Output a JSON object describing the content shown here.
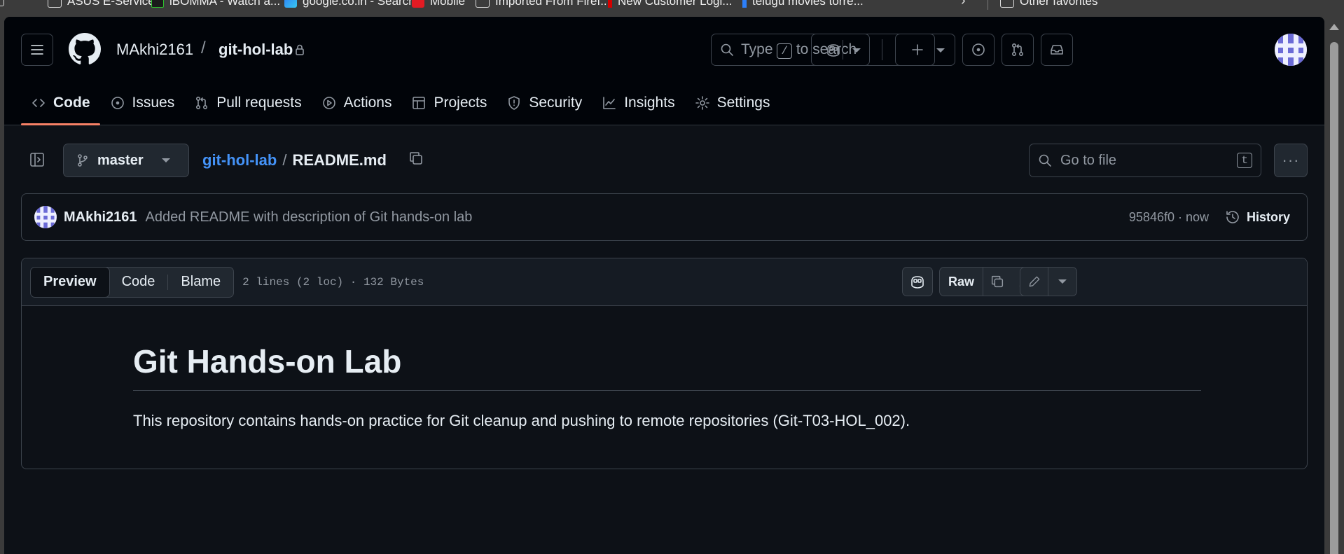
{
  "bookmarks": [
    {
      "label": "ASUS E-Service",
      "icon": "folder-icon"
    },
    {
      "label": "iBOMMA - Watch a...",
      "icon": "ibomma-icon"
    },
    {
      "label": "google.co.in - Search",
      "icon": "bing-icon"
    },
    {
      "label": "Mobile",
      "icon": "mobile-icon"
    },
    {
      "label": "Imported From Firef...",
      "icon": "folder-icon"
    },
    {
      "label": "New Customer Logi...",
      "icon": "red-icon"
    },
    {
      "label": "telugu movies torre...",
      "icon": "blue-icon"
    },
    {
      "label": "Other favorites",
      "icon": "folder-icon"
    }
  ],
  "header": {
    "owner": "MAkhi2161",
    "separator": "/",
    "repo": "git-hol-lab",
    "search_prefix": "Type",
    "search_key": "/",
    "search_suffix": "to search"
  },
  "tabs": [
    {
      "label": "Code",
      "icon": "code-icon"
    },
    {
      "label": "Issues",
      "icon": "issue-icon"
    },
    {
      "label": "Pull requests",
      "icon": "pull-request-icon"
    },
    {
      "label": "Actions",
      "icon": "play-icon"
    },
    {
      "label": "Projects",
      "icon": "table-icon"
    },
    {
      "label": "Security",
      "icon": "shield-icon"
    },
    {
      "label": "Insights",
      "icon": "graph-icon"
    },
    {
      "label": "Settings",
      "icon": "gear-icon"
    }
  ],
  "filebar": {
    "branch": "master",
    "path_repo": "git-hol-lab",
    "path_sep": "/",
    "path_file": "README.md",
    "goto_placeholder": "Go to file",
    "goto_key": "t",
    "more": "···"
  },
  "commit": {
    "author": "MAkhi2161",
    "message": "Added README with description of Git hands-on lab",
    "meta": "95846f0 · now",
    "history": "History"
  },
  "fileview": {
    "mode_preview": "Preview",
    "mode_code": "Code",
    "mode_blame": "Blame",
    "info": "2 lines (2 loc) · 132 Bytes",
    "raw": "Raw"
  },
  "readme": {
    "title": "Git Hands-on Lab",
    "body": "This repository contains hands-on practice for Git cleanup and pushing to remote repositories (Git-T03-HOL_002)."
  },
  "colors": {
    "background": "#0d1117",
    "header": "#010409",
    "accent_link": "#4493f8",
    "active_tab_underline": "#f78166"
  }
}
